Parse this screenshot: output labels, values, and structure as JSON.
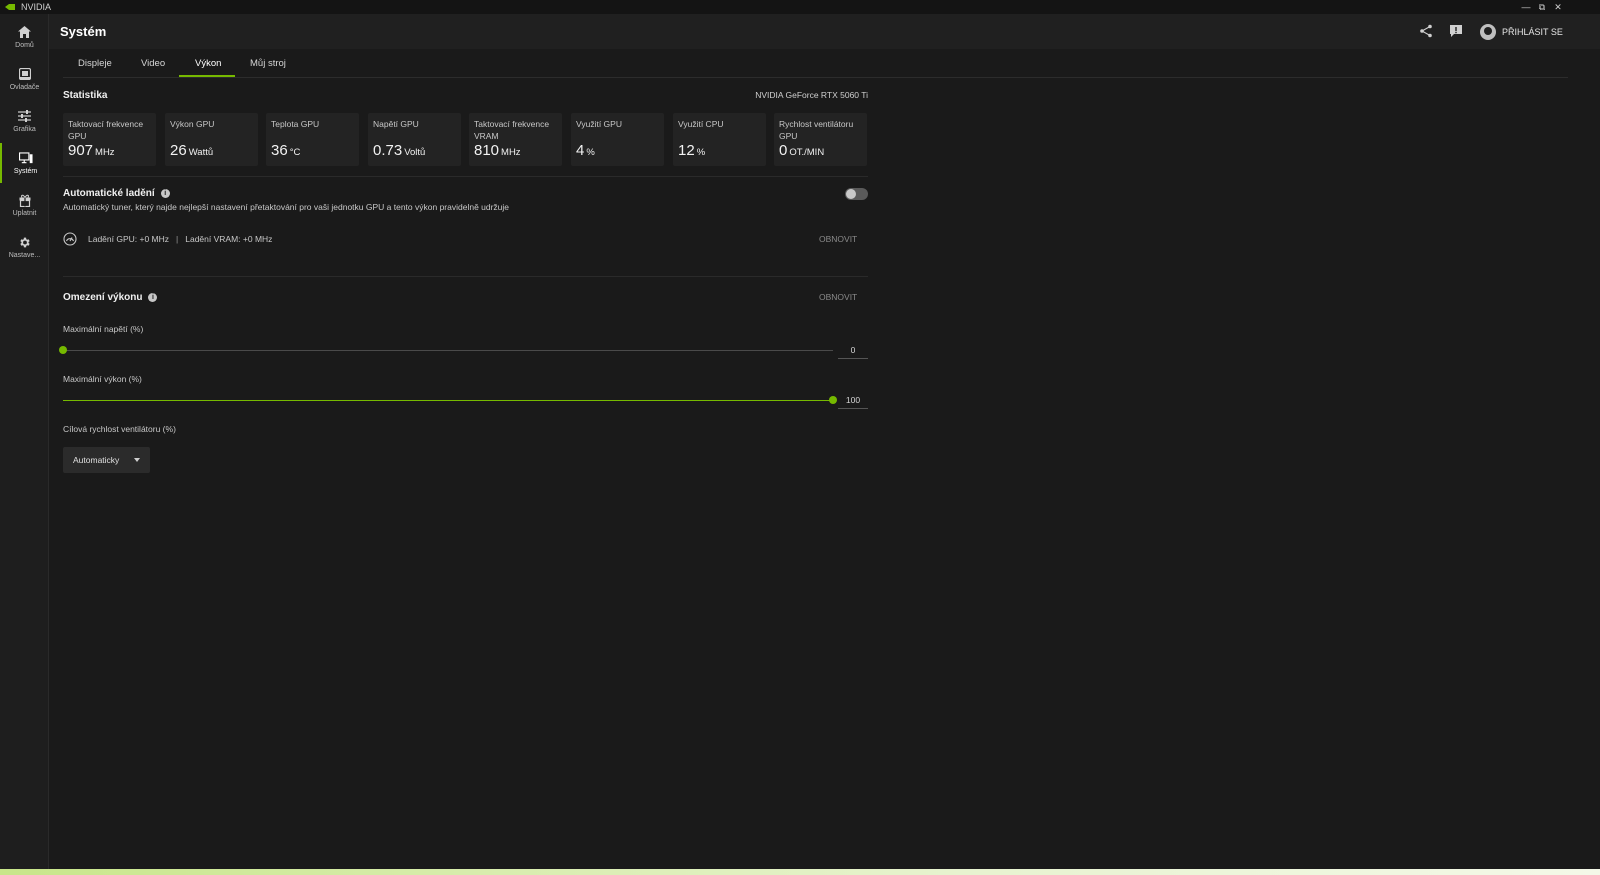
{
  "app": {
    "name": "NVIDIA",
    "brand_color": "#76b900"
  },
  "window_controls": [
    "minimize-icon",
    "restore-icon",
    "close-icon"
  ],
  "sidebar": {
    "items": [
      {
        "label": "Domů",
        "icon": "home-icon"
      },
      {
        "label": "Ovladače",
        "icon": "driver-icon"
      },
      {
        "label": "Grafika",
        "icon": "sliders-icon"
      },
      {
        "label": "Systém",
        "icon": "monitor-icon",
        "active": true
      },
      {
        "label": "Uplatnit",
        "icon": "gift-icon"
      },
      {
        "label": "Nastave...",
        "icon": "gear-icon"
      }
    ]
  },
  "header": {
    "title": "Systém",
    "share_icon": "share-icon",
    "feedback_icon": "feedback-icon",
    "signin_label": "PŘIHLÁSIT SE"
  },
  "tabs": [
    {
      "label": "Displeje"
    },
    {
      "label": "Video"
    },
    {
      "label": "Výkon",
      "active": true
    },
    {
      "label": "Můj stroj"
    }
  ],
  "stats": {
    "title": "Statistika",
    "gpu_name": "NVIDIA GeForce RTX 5060 Ti",
    "cards": [
      {
        "label": "Taktovací frekvence GPU",
        "value": "907",
        "unit": "MHz"
      },
      {
        "label": "Výkon GPU",
        "value": "26",
        "unit": "Wattů"
      },
      {
        "label": "Teplota GPU",
        "value": "36",
        "unit": "°C"
      },
      {
        "label": "Napětí GPU",
        "value": "0.73",
        "unit": "Voltů"
      },
      {
        "label": "Taktovací frekvence VRAM",
        "value": "810",
        "unit": "MHz"
      },
      {
        "label": "Využití GPU",
        "value": "4",
        "unit": "%"
      },
      {
        "label": "Využití CPU",
        "value": "12",
        "unit": "%"
      },
      {
        "label": "Rychlost ventilátoru GPU",
        "value": "0",
        "unit": "OT./MIN"
      }
    ]
  },
  "auto_tuning": {
    "title": "Automatické ladění",
    "description": "Automatický tuner, který najde nejlepší nastavení přetaktování pro vaši jednotku GPU a tento výkon pravidelně udržuje",
    "enabled": false,
    "gpu_tuning": "Ladění GPU: +0 MHz",
    "separator": "|",
    "vram_tuning": "Ladění VRAM: +0 MHz",
    "reset_label": "OBNOVIT"
  },
  "performance_limits": {
    "title": "Omezení výkonu",
    "reset_label": "OBNOVIT",
    "max_voltage": {
      "label": "Maximální napětí (%)",
      "value": "0",
      "fraction": 0.0
    },
    "max_power": {
      "label": "Maximální výkon (%)",
      "value": "100",
      "fraction": 1.0
    },
    "fan_target": {
      "label": "Cílová rychlost ventilátoru (%)",
      "selected": "Automaticky"
    }
  }
}
